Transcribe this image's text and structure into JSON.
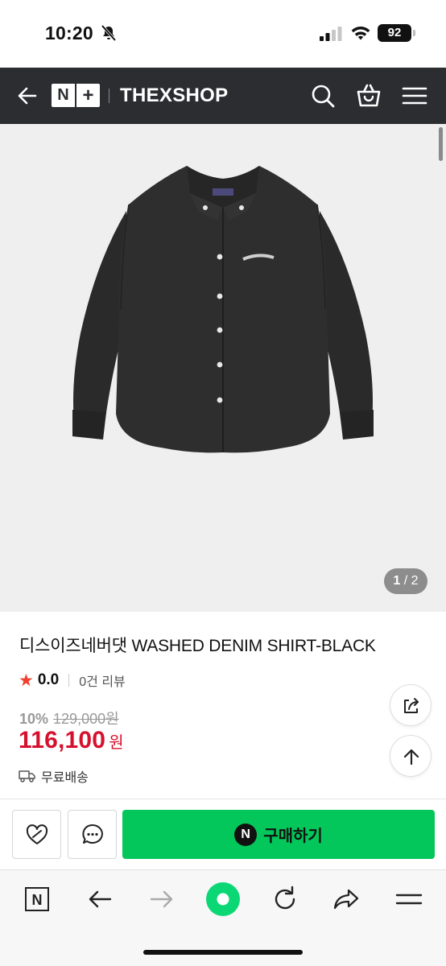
{
  "status_bar": {
    "time": "10:20",
    "battery": "92"
  },
  "header": {
    "logo_n": "N",
    "logo_plus": "+",
    "shop_name": "THEXSHOP"
  },
  "image": {
    "pager_current": "1",
    "pager_total": " / 2"
  },
  "product": {
    "title": "디스이즈네버댓 WASHED DENIM SHIRT-BLACK",
    "rating": "0.0",
    "review_count": "0건 리뷰",
    "discount": "10%",
    "original_price": "129,000원",
    "price": "116,100",
    "currency": "원",
    "shipping": "무료배송"
  },
  "purchase": {
    "buy_badge": "N",
    "buy_label": "구매하기"
  },
  "toolbar": {
    "n_label": "N"
  },
  "colors": {
    "header_bg": "#2b2d31",
    "price_red": "#d6112d",
    "buy_green": "#03c75a",
    "star": "#f03e2f"
  }
}
